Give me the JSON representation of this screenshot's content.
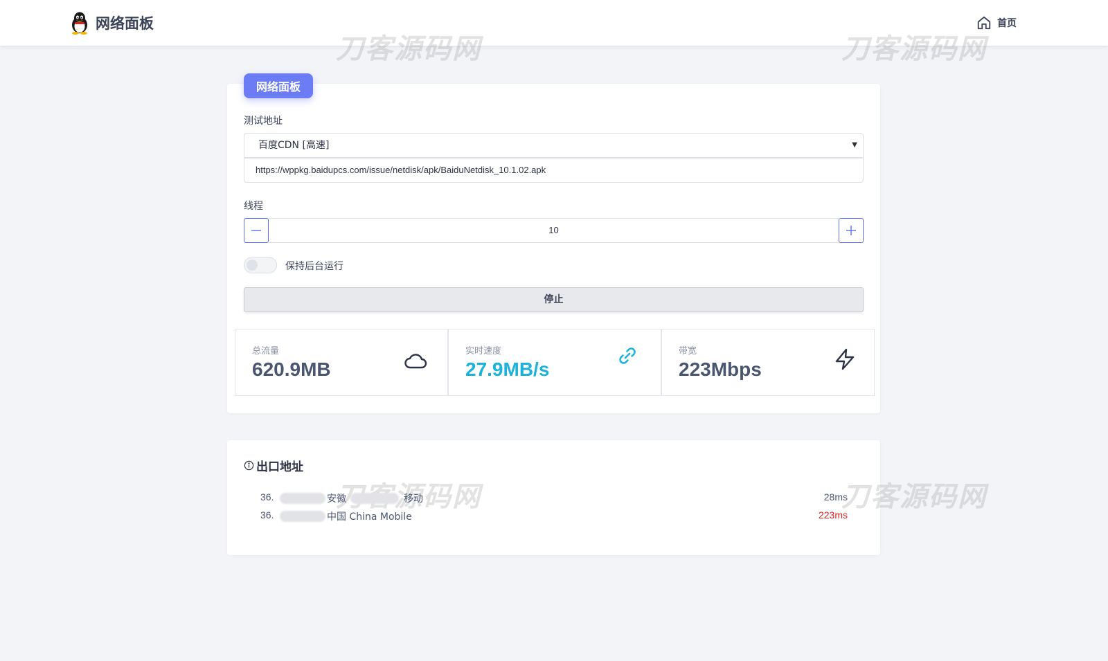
{
  "header": {
    "app_title": "网络面板",
    "logo_icon": "qq-penguin-icon",
    "home_label": "首页",
    "home_icon": "home-icon"
  },
  "watermark": "刀客源码网",
  "panel": {
    "badge": "网络面板",
    "test_url_label": "测试地址",
    "selected_source": "百度CDN [高速]",
    "url_value": "https://wppkg.baidupcs.com/issue/netdisk/apk/BaiduNetdisk_10.1.02.apk",
    "threads_label": "线程",
    "threads_value": "10",
    "background_toggle_label": "保持后台运行",
    "background_toggle_on": false,
    "stop_button": "停止",
    "stats": [
      {
        "label": "总流量",
        "value": "620.9MB",
        "icon": "cloud-icon"
      },
      {
        "label": "实时速度",
        "value": "27.9MB/s",
        "icon": "link-icon"
      },
      {
        "label": "带宽",
        "value": "223Mbps",
        "icon": "lightning-icon"
      }
    ]
  },
  "exit": {
    "title": "出口地址",
    "title_icon": "info-icon",
    "rows": [
      {
        "ip": "36.",
        "location_a": "安徽",
        "location_b": "移动",
        "latency": "28ms",
        "status_color": "#4a5670"
      },
      {
        "ip": "36.",
        "location": "中国 China Mobile",
        "latency": "223ms",
        "status_color": "#e02020"
      }
    ]
  },
  "colors": {
    "accent": "#6b7cf5",
    "speed": "#1bb3db",
    "slow": "#e02020",
    "background": "#f3f4f8"
  }
}
